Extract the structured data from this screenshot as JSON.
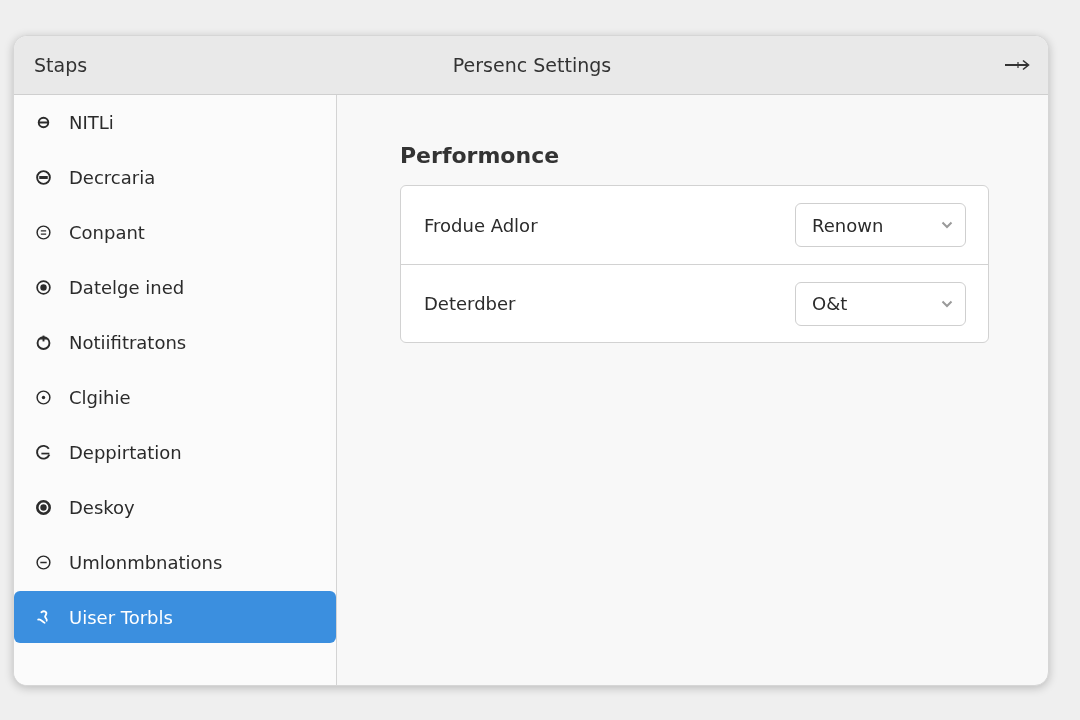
{
  "titlebar": {
    "app_name": "Staps",
    "title": "Persenc Settings"
  },
  "sidebar": {
    "items": [
      {
        "label": "NITLi",
        "selected": false
      },
      {
        "label": "Decrcaria",
        "selected": false
      },
      {
        "label": "Conpant",
        "selected": false
      },
      {
        "label": "Datelge ined",
        "selected": false
      },
      {
        "label": "Notiifitratons",
        "selected": false
      },
      {
        "label": "Clgihie",
        "selected": false
      },
      {
        "label": "Deppirtation",
        "selected": false
      },
      {
        "label": "Deskoy",
        "selected": false
      },
      {
        "label": "Umlonmbnations",
        "selected": false
      },
      {
        "label": "Uiser Torbls",
        "selected": true
      }
    ]
  },
  "content": {
    "section_title": "Performonce",
    "settings": [
      {
        "label": "Frodue Adlor",
        "value": "Renown"
      },
      {
        "label": "Deterdber",
        "value": "O&t"
      }
    ]
  }
}
